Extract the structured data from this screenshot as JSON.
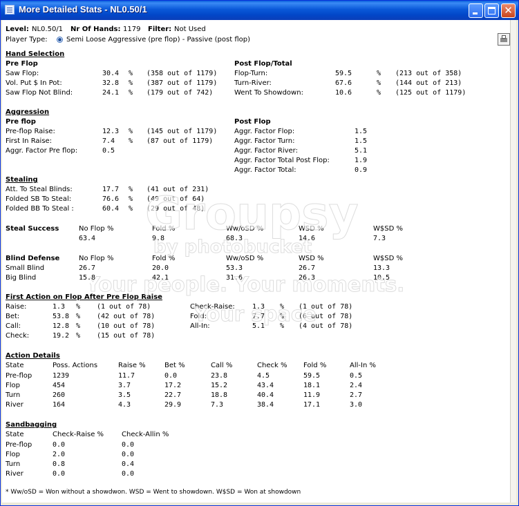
{
  "window": {
    "title": "More Detailed Stats - NL0.50/1"
  },
  "header": {
    "level_label": "Level:",
    "level_value": "NL0.50/1",
    "hands_label": "Nr Of Hands:",
    "hands_value": "1179",
    "filter_label": "Filter:",
    "filter_value": "Not Used",
    "player_type_label": "Player Type:",
    "player_type_value": "Semi Loose Aggressive (pre flop) - Passive (post flop)"
  },
  "hand_selection": {
    "title": "Hand Selection",
    "pre_title": "Pre Flop",
    "post_title": "Post Flop/Total",
    "pre": [
      {
        "label": "Saw Flop:",
        "value": "30.4",
        "unit": "%",
        "detail": "(358 out of 1179)"
      },
      {
        "label": "Vol. Put $ In Pot:",
        "value": "32.8",
        "unit": "%",
        "detail": "(387 out of 1179)"
      },
      {
        "label": "Saw Flop Not Blind:",
        "value": "24.1",
        "unit": "%",
        "detail": "(179 out of 742)"
      }
    ],
    "post": [
      {
        "label": "Flop-Turn:",
        "value": "59.5",
        "unit": "%",
        "detail": "(213 out of 358)"
      },
      {
        "label": "Turn-River:",
        "value": "67.6",
        "unit": "%",
        "detail": "(144 out of 213)"
      },
      {
        "label": "Went To Showdown:",
        "value": "10.6",
        "unit": "%",
        "detail": "(125 out of 1179)"
      }
    ]
  },
  "aggression": {
    "title": "Aggression",
    "pre_title": "Pre flop",
    "post_title": "Post Flop",
    "pre": [
      {
        "label": "Pre-flop Raise:",
        "value": "12.3",
        "unit": "%",
        "detail": "(145 out of 1179)"
      },
      {
        "label": "First In Raise:",
        "value": "7.4",
        "unit": "%",
        "detail": "(87 out of 1179)"
      },
      {
        "label": "Aggr. Factor Pre flop:",
        "value": "0.5",
        "unit": "",
        "detail": ""
      }
    ],
    "post": [
      {
        "label": "Aggr. Factor Flop:",
        "value": "1.5"
      },
      {
        "label": "Aggr. Factor Turn:",
        "value": "1.5"
      },
      {
        "label": "Aggr. Factor River:",
        "value": "5.1"
      },
      {
        "label": "Aggr. Factor Total Post Flop:",
        "value": "1.9"
      },
      {
        "label": "Aggr. Factor Total:",
        "value": "0.9"
      }
    ]
  },
  "stealing": {
    "title": "Stealing",
    "rows": [
      {
        "label": "Att. To Steal Blinds:",
        "value": "17.7",
        "unit": "%",
        "detail": "(41 out of 231)"
      },
      {
        "label": "Folded SB To Steal:",
        "value": "76.6",
        "unit": "%",
        "detail": "(49 out of 64)"
      },
      {
        "label": "Folded BB To Steal :",
        "value": "60.4",
        "unit": "%",
        "detail": "(29 out of 48)"
      }
    ]
  },
  "steal_success": {
    "title": "Steal Success",
    "headers": [
      "No Flop %",
      "Fold %",
      "Ww/oSD %",
      "WSD %",
      "W$SD %"
    ],
    "values": [
      "63.4",
      "9.8",
      "68.3",
      "14.6",
      "7.3"
    ]
  },
  "blind_defense": {
    "title": "Blind Defense",
    "headers": [
      "No Flop %",
      "Fold %",
      "Ww/oSD %",
      "WSD %",
      "W$SD %"
    ],
    "rows": [
      {
        "label": "Small Blind",
        "values": [
          "26.7",
          "20.0",
          "53.3",
          "26.7",
          "13.3"
        ]
      },
      {
        "label": "Big Blind",
        "values": [
          "15.8",
          "42.1",
          "31.6",
          "26.3",
          "10.5"
        ]
      }
    ]
  },
  "first_action": {
    "title": "First Action on Flop After Pre Flop Raise",
    "left": [
      {
        "label": "Raise:",
        "value": "1.3",
        "unit": "%",
        "detail": "(1 out of 78)"
      },
      {
        "label": "Bet:",
        "value": "53.8",
        "unit": "%",
        "detail": "(42 out of 78)"
      },
      {
        "label": "Call:",
        "value": "12.8",
        "unit": "%",
        "detail": "(10 out of 78)"
      },
      {
        "label": "Check:",
        "value": "19.2",
        "unit": "%",
        "detail": "(15 out of 78)"
      }
    ],
    "right": [
      {
        "label": "Check-Raise:",
        "value": "1.3",
        "unit": "%",
        "detail": "(1 out of 78)"
      },
      {
        "label": "Fold:",
        "value": "7.7",
        "unit": "%",
        "detail": "(6 out of 78)"
      },
      {
        "label": "All-In:",
        "value": "5.1",
        "unit": "%",
        "detail": "(4 out of 78)"
      }
    ]
  },
  "action_details": {
    "title": "Action Details",
    "headers": [
      "State",
      "Poss. Actions",
      "Raise %",
      "Bet %",
      "Call %",
      "Check %",
      "Fold %",
      "All-In %"
    ],
    "rows": [
      [
        "Pre-flop",
        "1239",
        "11.7",
        "0.0",
        "23.8",
        "4.5",
        "59.5",
        "0.5"
      ],
      [
        "Flop",
        "454",
        "3.7",
        "17.2",
        "15.2",
        "43.4",
        "18.1",
        "2.4"
      ],
      [
        "Turn",
        "260",
        "3.5",
        "22.7",
        "18.8",
        "40.4",
        "11.9",
        "2.7"
      ],
      [
        "River",
        "164",
        "4.3",
        "29.9",
        "7.3",
        "38.4",
        "17.1",
        "3.0"
      ]
    ]
  },
  "sandbagging": {
    "title": "Sandbagging",
    "headers": [
      "State",
      "Check-Raise %",
      "Check-Allin %"
    ],
    "rows": [
      [
        "Pre-flop",
        "0.0",
        "0.0"
      ],
      [
        "Flop",
        "2.0",
        "0.0"
      ],
      [
        "Turn",
        "0.8",
        "0.4"
      ],
      [
        "River",
        "0.0",
        "0.0"
      ]
    ]
  },
  "footnote": "* Ww/oSD = Won without a showdwon. WSD = Went to showdown. W$SD = Won at showdown",
  "watermark": {
    "brand": "Groupsy",
    "sub": "by photobucket",
    "line1": "Your people. Your moments.",
    "line2": "Your space"
  },
  "colors": {
    "titlebar": "#0a58d8",
    "window_bg": "#ece9d8",
    "content_bg": "#ffffff",
    "close_button": "#c9441c"
  },
  "icons": {
    "title": "stats-window-icon",
    "print": "print-icon",
    "minimize": "minimize-icon",
    "maximize": "maximize-icon",
    "close": "close-icon"
  }
}
